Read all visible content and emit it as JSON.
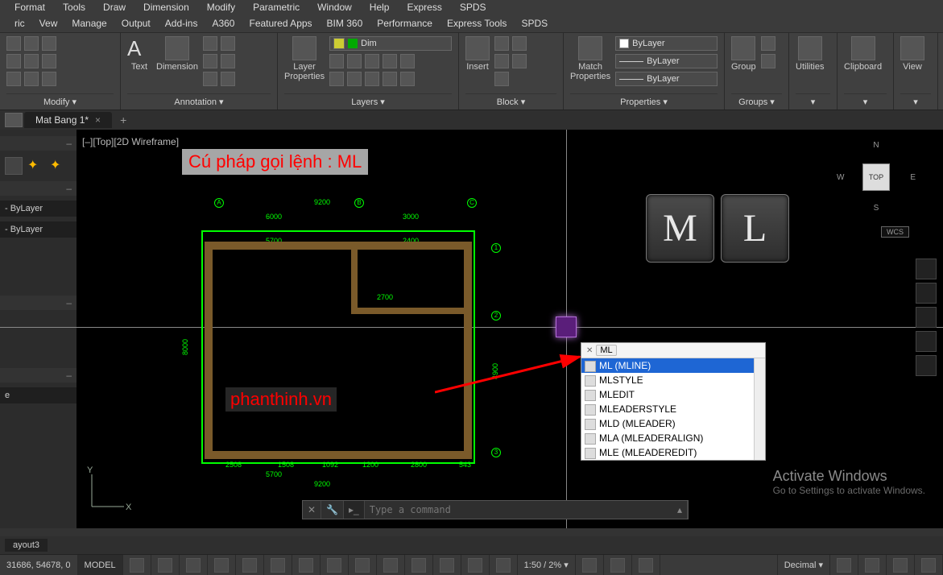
{
  "menubar": [
    "Format",
    "Tools",
    "Draw",
    "Dimension",
    "Modify",
    "Parametric",
    "Window",
    "Help",
    "Express",
    "SPDS"
  ],
  "ribtabs": [
    "ric",
    "Vew",
    "Manage",
    "Output",
    "Add-ins",
    "A360",
    "Featured Apps",
    "BIM 360",
    "Performance",
    "Express Tools",
    "SPDS"
  ],
  "panels": {
    "modify": {
      "label": "Modify ▾"
    },
    "annotation": {
      "label": "Annotation ▾",
      "text": "Text",
      "dimension": "Dimension"
    },
    "layers": {
      "label": "Layers ▾",
      "btn": "Layer\nProperties",
      "combo": "Dim"
    },
    "block": {
      "label": "Block ▾",
      "btn": "Insert"
    },
    "properties": {
      "label": "Properties ▾",
      "btn": "Match\nProperties",
      "layer": "ByLayer",
      "lw": "ByLayer",
      "lt": "ByLayer"
    },
    "groups": {
      "label": "Groups ▾",
      "btn": "Group"
    },
    "utilities": {
      "label": "Utilities"
    },
    "clipboard": {
      "label": "Clipboard"
    },
    "view": {
      "label": "View"
    }
  },
  "dtab": {
    "name": "Mat Bang 1*",
    "close": "×",
    "add": "+"
  },
  "viewlabel": "[–][Top][2D Wireframe]",
  "palette": {
    "bylayer1": "- ByLayer",
    "bylayer2": "- ByLayer",
    "e": "e"
  },
  "annotation_text": "Cú pháp gọi lệnh : ML",
  "watermark": "phanthinh.vn",
  "key_m": "M",
  "key_l": "L",
  "ac_input": "ML",
  "ac_items": [
    "ML (MLINE)",
    "MLSTYLE",
    "MLEDIT",
    "MLEADERSTYLE",
    "MLD (MLEADER)",
    "MLA (MLEADERALIGN)",
    "MLE (MLEADEREDIT)"
  ],
  "cmd_placeholder": "Type a command",
  "viewcube": {
    "face": "TOP",
    "n": "N",
    "s": "S",
    "e": "E",
    "w": "W",
    "wcs": "WCS"
  },
  "ucs": {
    "x": "X",
    "y": "Y"
  },
  "layout_tab": "ayout3",
  "status": {
    "coords": "31686, 54678, 0",
    "model": "MODEL",
    "scale": "1:50 / 2% ▾",
    "units": "Decimal ▾"
  },
  "plan_dims": {
    "top_total": "9200",
    "top_l": "6000",
    "top_r": "3000",
    "span_l": "5700",
    "span_r": "2400",
    "h_left": "8000",
    "mid": "2700",
    "bot_total": "9200",
    "bot_span": "5700",
    "b1": "2508",
    "b2": "1508",
    "b3": "1092",
    "b4": "1200",
    "b5": "2800",
    "b6": "543",
    "h_r": "4900"
  },
  "plan_grids": {
    "a": "A",
    "b": "B",
    "c": "C",
    "r1": "1",
    "r2": "2",
    "r3": "3"
  },
  "actwin": {
    "t1": "Activate Windows",
    "t2": "Go to Settings to activate Windows."
  }
}
